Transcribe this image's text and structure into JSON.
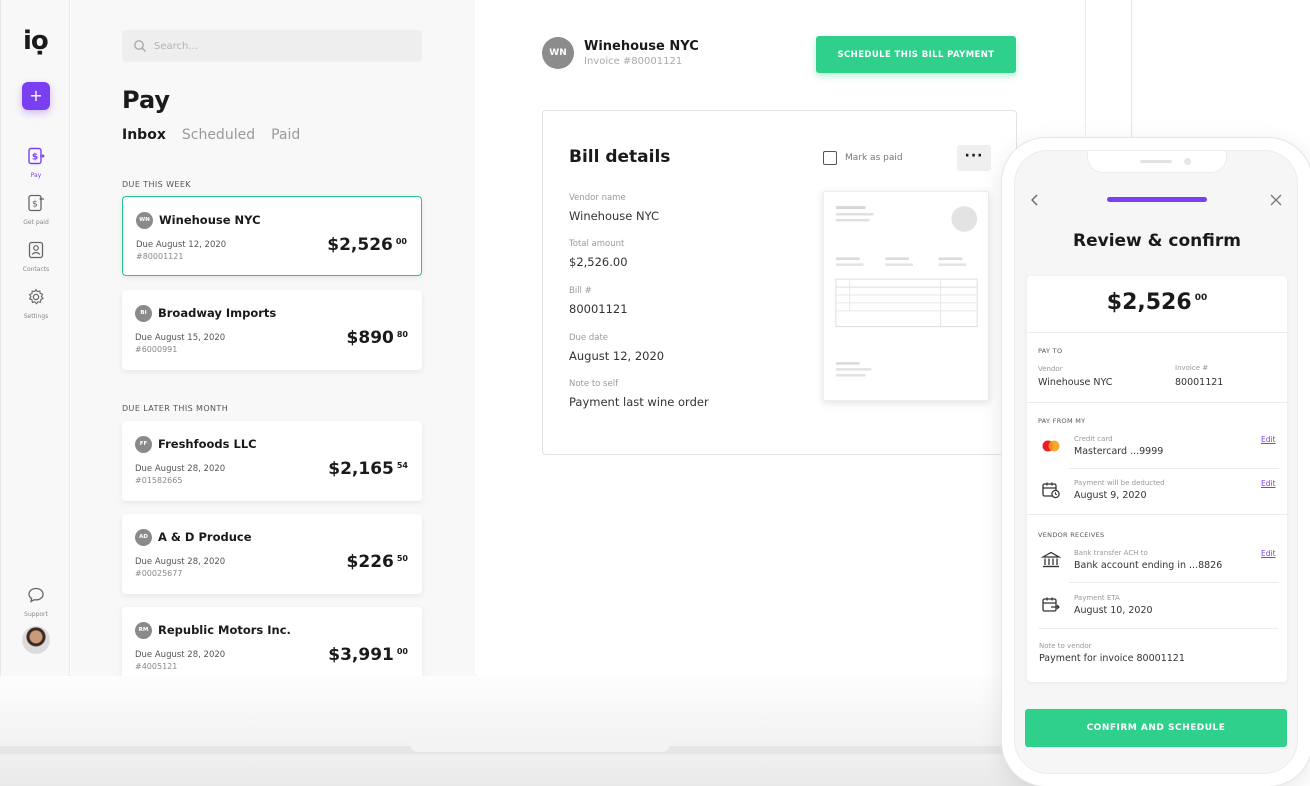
{
  "app": {
    "logo": "iọ"
  },
  "sidebar": {
    "add_label": "+",
    "items": [
      {
        "label": "Pay",
        "icon": "dollar-send-icon"
      },
      {
        "label": "Get paid",
        "icon": "dollar-receive-icon"
      },
      {
        "label": "Contacts",
        "icon": "contacts-icon"
      },
      {
        "label": "Settings",
        "icon": "gear-icon"
      }
    ],
    "support_label": "Support"
  },
  "list": {
    "search_placeholder": "Search...",
    "title": "Pay",
    "tabs": [
      "Inbox",
      "Scheduled",
      "Paid"
    ],
    "sections": [
      {
        "label": "DUE THIS WEEK"
      },
      {
        "label": "DUE LATER THIS MONTH"
      }
    ],
    "bills": [
      {
        "initials": "WN",
        "vendor": "Winehouse NYC",
        "due": "Due August 12, 2020",
        "number": "#80001121",
        "dollars": "$2,526",
        "cents": "00"
      },
      {
        "initials": "BI",
        "vendor": "Broadway Imports",
        "due": "Due August 15, 2020",
        "number": "#6000991",
        "dollars": "$890",
        "cents": "80"
      },
      {
        "initials": "FF",
        "vendor": "Freshfoods LLC",
        "due": "Due August 28, 2020",
        "number": "#01582665",
        "dollars": "$2,165",
        "cents": "54"
      },
      {
        "initials": "AD",
        "vendor": "A & D Produce",
        "due": "Due August 28, 2020",
        "number": "#00025677",
        "dollars": "$226",
        "cents": "50"
      },
      {
        "initials": "RM",
        "vendor": "Republic Motors Inc.",
        "due": "Due August 28, 2020",
        "number": "#4005121",
        "dollars": "$3,991",
        "cents": "00"
      }
    ]
  },
  "detail": {
    "initials": "WN",
    "vendor": "Winehouse NYC",
    "invoice": "Invoice #80001121",
    "schedule_button": "SCHEDULE THIS BILL PAYMENT",
    "heading": "Bill details",
    "mark_paid": "Mark as paid",
    "more": "···",
    "fields": [
      {
        "label": "Vendor name",
        "value": "Winehouse NYC"
      },
      {
        "label": "Total amount",
        "value": "$2,526.00"
      },
      {
        "label": "Bill #",
        "value": "80001121"
      },
      {
        "label": "Due date",
        "value": "August 12, 2020"
      },
      {
        "label": "Note to self",
        "value": "Payment last wine order"
      }
    ]
  },
  "mobile": {
    "title": "Review & confirm",
    "progress": 0.5,
    "dollars": "$2,526",
    "cents": "00",
    "pay_to_label": "PAY TO",
    "vendor_label": "Vendor",
    "vendor_value": "Winehouse NYC",
    "invoice_label": "Invoice #",
    "invoice_value": "80001121",
    "pay_from_label": "PAY FROM MY",
    "card_label": "Credit card",
    "card_value": "Mastercard ...9999",
    "deduct_label": "Payment will be deducted",
    "deduct_value": "August 9, 2020",
    "vendor_receives_label": "VENDOR RECEIVES",
    "bank_label": "Bank transfer ACH to",
    "bank_value": "Bank account ending in ...8826",
    "eta_label": "Payment ETA",
    "eta_value": "August 10, 2020",
    "note_label": "Note to vendor",
    "note_value": "Payment for invoice 80001121",
    "edit_label": "Edit",
    "confirm_button": "CONFIRM AND SCHEDULE"
  },
  "colors": {
    "accent": "#7b3ff2",
    "green": "#2fd08c",
    "selected_border": "#25c784"
  }
}
